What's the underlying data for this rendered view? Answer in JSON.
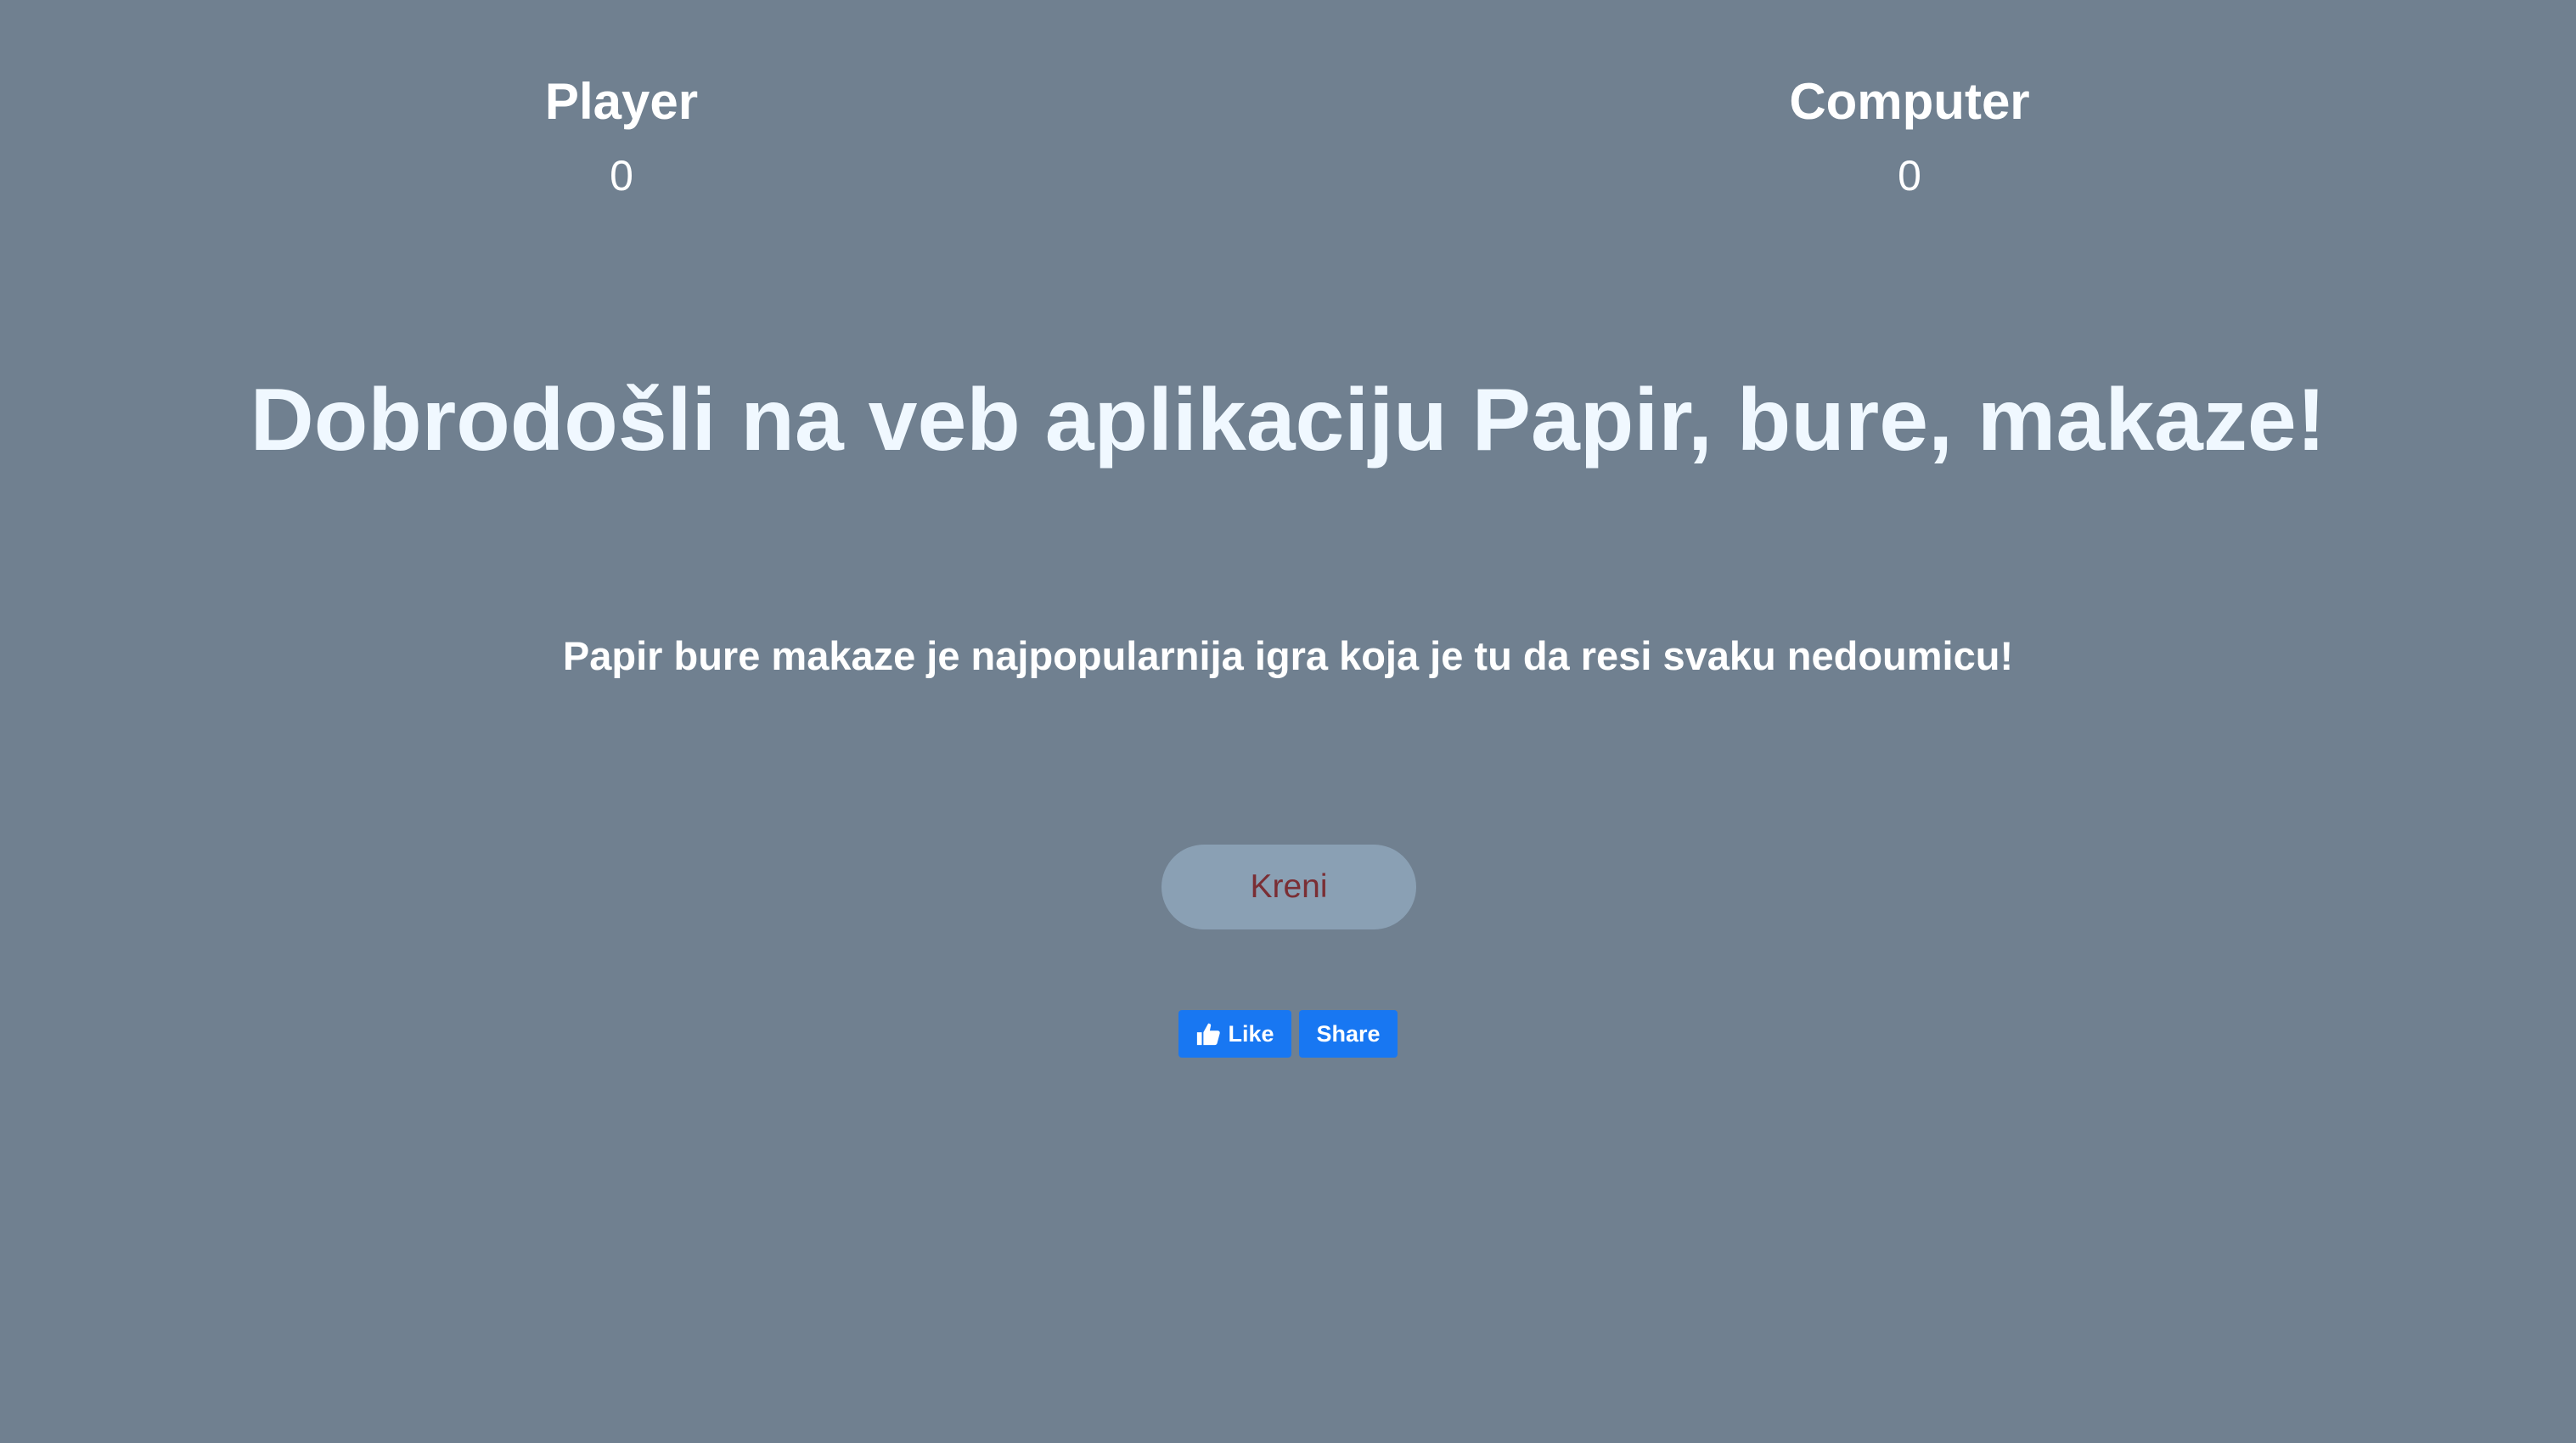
{
  "scoreboard": {
    "player": {
      "label": "Player",
      "score": "0"
    },
    "computer": {
      "label": "Computer",
      "score": "0"
    }
  },
  "main": {
    "heading": "Dobrodošli na veb aplikaciju Papir, bure, makaze!",
    "subheading": "Papir bure makaze je najpopularnija igra koja je tu da resi svaku nedoumicu!",
    "start_button": "Kreni"
  },
  "social": {
    "like_label": "Like",
    "share_label": "Share",
    "like_icon": "thumbs-up-icon"
  },
  "colors": {
    "background": "#708090",
    "button_bg": "#8aa0b4",
    "button_text": "#7a2e34",
    "facebook_blue": "#1877f2"
  }
}
